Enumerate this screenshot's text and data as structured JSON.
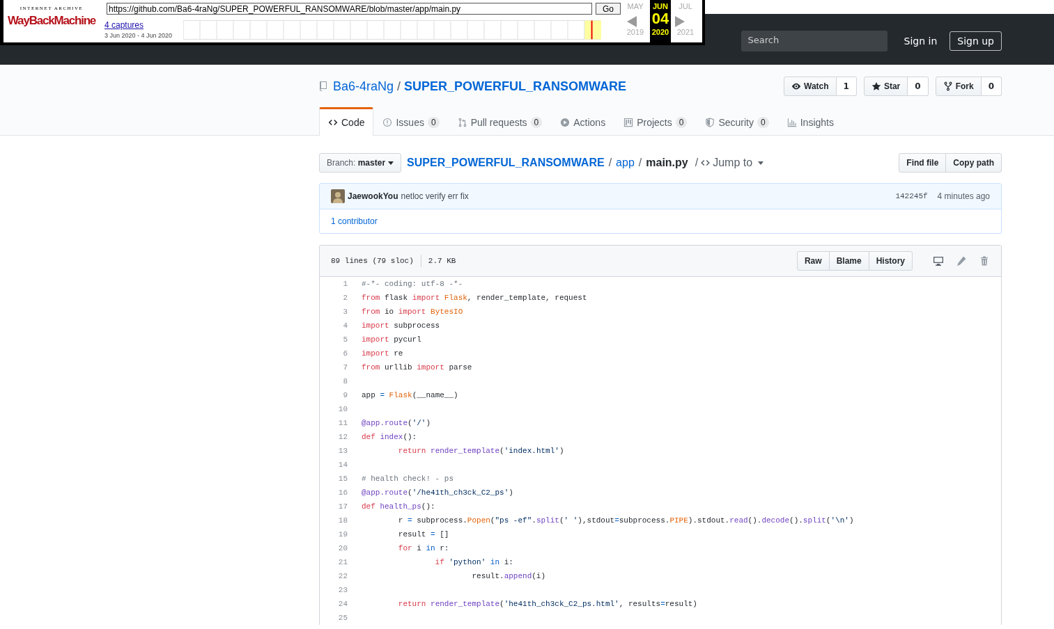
{
  "wayback": {
    "logo_top": "INTERNET ARCHIVE",
    "logo": "WayBackMachine",
    "url": "https://github.com/Ba6-4raNg/SUPER_POWERFUL_RANSOMWARE/blob/master/app/main.py",
    "go": "Go",
    "captures": "4 captures",
    "date_range": "3 Jun 2020 - 4 Jun 2020",
    "months": [
      {
        "label": "MAY",
        "selected": false
      },
      {
        "label": "JUN",
        "selected": true
      },
      {
        "label": "JUL",
        "selected": false
      }
    ],
    "day": "04",
    "years": [
      {
        "label": "2019",
        "selected": false
      },
      {
        "label": "2020",
        "selected": true
      },
      {
        "label": "2021",
        "selected": false
      }
    ]
  },
  "github_header": {
    "search_placeholder": "Search",
    "sign_in": "Sign in",
    "sign_up": "Sign up"
  },
  "repo": {
    "owner": "Ba6-4raNg",
    "separator": "/",
    "name": "SUPER_POWERFUL_RANSOMWARE",
    "actions": [
      {
        "kind": "watch",
        "label": "Watch",
        "count": "1"
      },
      {
        "kind": "star",
        "label": "Star",
        "count": "0"
      },
      {
        "kind": "fork",
        "label": "Fork",
        "count": "0"
      }
    ]
  },
  "tabs": [
    {
      "kind": "code",
      "label": "Code",
      "selected": true
    },
    {
      "kind": "issues",
      "label": "Issues",
      "count": "0",
      "selected": false
    },
    {
      "kind": "pulls",
      "label": "Pull requests",
      "count": "0",
      "selected": false
    },
    {
      "kind": "actions",
      "label": "Actions",
      "selected": false
    },
    {
      "kind": "projects",
      "label": "Projects",
      "count": "0",
      "selected": false
    },
    {
      "kind": "security",
      "label": "Security",
      "count": "0",
      "selected": false
    },
    {
      "kind": "insights",
      "label": "Insights",
      "selected": false
    }
  ],
  "file_nav": {
    "branch_label": "Branch:",
    "branch": "master",
    "path": [
      {
        "name": "SUPER_POWERFUL_RANSOMWARE",
        "separator": "/"
      },
      {
        "name": "app",
        "separator": "/"
      }
    ],
    "file": "main.py",
    "file_separator": "/",
    "jump": "Jump to",
    "buttons": [
      "Find file",
      "Copy path"
    ]
  },
  "commit": {
    "author": "JaewookYou",
    "message": "netloc verify err fix",
    "sha": "142245f",
    "time": "4 minutes ago",
    "contributors": "1 contributor"
  },
  "file": {
    "lines_info": "89 lines (79 sloc)",
    "size": "2.7 KB",
    "buttons": [
      "Raw",
      "Blame",
      "History"
    ],
    "code": [
      {
        "n": "1",
        "tokens": [
          {
            "kind": "comment",
            "text": "#-*- coding: utf-8 -*-"
          }
        ]
      },
      {
        "n": "2",
        "tokens": [
          {
            "kind": "keyword",
            "text": "from"
          },
          {
            "kind": "plain",
            "text": " flask "
          },
          {
            "kind": "keyword",
            "text": "import "
          },
          {
            "kind": "class",
            "text": "Flask"
          },
          {
            "kind": "plain",
            "text": ", render_template, request"
          }
        ]
      },
      {
        "n": "3",
        "tokens": [
          {
            "kind": "keyword",
            "text": "from"
          },
          {
            "kind": "plain",
            "text": " io "
          },
          {
            "kind": "keyword",
            "text": "import "
          },
          {
            "kind": "class",
            "text": "BytesIO"
          }
        ]
      },
      {
        "n": "4",
        "tokens": [
          {
            "kind": "keyword",
            "text": "import"
          },
          {
            "kind": "plain",
            "text": " subprocess"
          }
        ]
      },
      {
        "n": "5",
        "tokens": [
          {
            "kind": "keyword",
            "text": "import"
          },
          {
            "kind": "plain",
            "text": " pycurl"
          }
        ]
      },
      {
        "n": "6",
        "tokens": [
          {
            "kind": "keyword",
            "text": "import"
          },
          {
            "kind": "plain",
            "text": " re"
          }
        ]
      },
      {
        "n": "7",
        "tokens": [
          {
            "kind": "keyword",
            "text": "from"
          },
          {
            "kind": "plain",
            "text": " urllib "
          },
          {
            "kind": "keyword",
            "text": "import"
          },
          {
            "kind": "plain",
            "text": " parse"
          }
        ]
      },
      {
        "n": "8"
      },
      {
        "n": "9",
        "tokens": [
          {
            "kind": "plain",
            "text": "app "
          },
          {
            "kind": "operator",
            "text": "= "
          },
          {
            "kind": "class",
            "text": "Flask"
          },
          {
            "kind": "plain",
            "text": "(__name__)"
          }
        ]
      },
      {
        "n": "10"
      },
      {
        "n": "11",
        "tokens": [
          {
            "kind": "function",
            "text": "@app.route"
          },
          {
            "kind": "plain",
            "text": "("
          },
          {
            "kind": "string",
            "text": "'/'"
          },
          {
            "kind": "plain",
            "text": ")"
          }
        ]
      },
      {
        "n": "12",
        "tokens": [
          {
            "kind": "keyword",
            "text": "def "
          },
          {
            "kind": "function",
            "text": "index"
          },
          {
            "kind": "plain",
            "text": "():"
          }
        ]
      },
      {
        "n": "13",
        "tokens": [
          {
            "kind": "keyword",
            "text": "        return "
          },
          {
            "kind": "function",
            "text": "render_template"
          },
          {
            "kind": "plain",
            "text": "("
          },
          {
            "kind": "string",
            "text": "'index.html'"
          },
          {
            "kind": "plain",
            "text": ")"
          }
        ]
      },
      {
        "n": "14"
      },
      {
        "n": "15",
        "tokens": [
          {
            "kind": "comment",
            "text": "# health check! - ps"
          }
        ]
      },
      {
        "n": "16",
        "tokens": [
          {
            "kind": "function",
            "text": "@app.route"
          },
          {
            "kind": "plain",
            "text": "("
          },
          {
            "kind": "string",
            "text": "'/he41th_ch3ck_C2_ps'"
          },
          {
            "kind": "plain",
            "text": ")"
          }
        ]
      },
      {
        "n": "17",
        "tokens": [
          {
            "kind": "keyword",
            "text": "def "
          },
          {
            "kind": "function",
            "text": "health_ps"
          },
          {
            "kind": "plain",
            "text": "():"
          }
        ]
      },
      {
        "n": "18",
        "tokens": [
          {
            "kind": "plain",
            "text": "        r "
          },
          {
            "kind": "operator",
            "text": "="
          },
          {
            "kind": "plain",
            "text": " subprocess."
          },
          {
            "kind": "class",
            "text": "Popen"
          },
          {
            "kind": "plain",
            "text": "("
          },
          {
            "kind": "string",
            "text": "\"ps -ef\""
          },
          {
            "kind": "plain",
            "text": "."
          },
          {
            "kind": "function",
            "text": "split"
          },
          {
            "kind": "plain",
            "text": "("
          },
          {
            "kind": "string",
            "text": "' '"
          },
          {
            "kind": "plain",
            "text": "),stdout"
          },
          {
            "kind": "operator",
            "text": "="
          },
          {
            "kind": "plain",
            "text": "subprocess."
          },
          {
            "kind": "class",
            "text": "PIPE"
          },
          {
            "kind": "plain",
            "text": ").stdout."
          },
          {
            "kind": "function",
            "text": "read"
          },
          {
            "kind": "plain",
            "text": "()."
          },
          {
            "kind": "function",
            "text": "decode"
          },
          {
            "kind": "plain",
            "text": "()."
          },
          {
            "kind": "function",
            "text": "split"
          },
          {
            "kind": "plain",
            "text": "("
          },
          {
            "kind": "string",
            "text": "'\\n'"
          },
          {
            "kind": "plain",
            "text": ")"
          }
        ]
      },
      {
        "n": "19",
        "tokens": [
          {
            "kind": "plain",
            "text": "        result "
          },
          {
            "kind": "operator",
            "text": "="
          },
          {
            "kind": "plain",
            "text": " []"
          }
        ]
      },
      {
        "n": "20",
        "tokens": [
          {
            "kind": "keyword",
            "text": "        for"
          },
          {
            "kind": "plain",
            "text": " i "
          },
          {
            "kind": "operator",
            "text": "in"
          },
          {
            "kind": "plain",
            "text": " r:"
          }
        ]
      },
      {
        "n": "21",
        "tokens": [
          {
            "kind": "keyword",
            "text": "                if "
          },
          {
            "kind": "string",
            "text": "'python'"
          },
          {
            "kind": "operator",
            "text": " in"
          },
          {
            "kind": "plain",
            "text": " i:"
          }
        ]
      },
      {
        "n": "22",
        "tokens": [
          {
            "kind": "plain",
            "text": "                        result."
          },
          {
            "kind": "function",
            "text": "append"
          },
          {
            "kind": "plain",
            "text": "(i)"
          }
        ]
      },
      {
        "n": "23"
      },
      {
        "n": "24",
        "tokens": [
          {
            "kind": "keyword",
            "text": "        return "
          },
          {
            "kind": "function",
            "text": "render_template"
          },
          {
            "kind": "plain",
            "text": "("
          },
          {
            "kind": "string",
            "text": "'he41th_ch3ck_C2_ps.html'"
          },
          {
            "kind": "plain",
            "text": ", results"
          },
          {
            "kind": "operator",
            "text": "="
          },
          {
            "kind": "plain",
            "text": "result)"
          }
        ]
      },
      {
        "n": "25"
      }
    ]
  }
}
